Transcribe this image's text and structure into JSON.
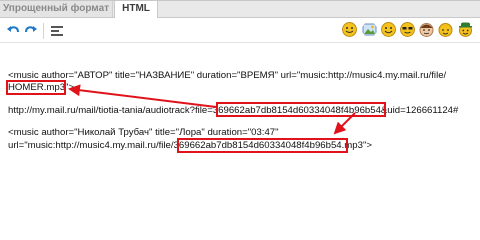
{
  "tabs": [
    {
      "label": "Упрощенный формат"
    },
    {
      "label": "HTML"
    }
  ],
  "toolbar": {
    "icons": [
      "undo-icon",
      "redo-icon",
      "format-icon",
      "image-icon",
      "video-icon",
      "music-icon",
      "smile-icon",
      "smile-wink-icon",
      "smile-cool-icon",
      "smile-girl-icon",
      "smile-hat-icon"
    ]
  },
  "editor": {
    "line1": "<music author=\"АВТОР\" title=\"НАЗВАНИЕ\" duration=\"ВРЕМЯ\" url=\"music:http://music4.my.mail.ru/file/",
    "line2": "HOMER.mp3\">",
    "line3": "http://my.mail.ru/mail/tiotia-tania/audiotrack?file=369662ab7db8154d60334048f4b96b54&uid=126661124#",
    "line4": "<music author=\"Николай Трубач\" title=\"Лора\" duration=\"03:47\"",
    "line5": "url=\"music:http://music4.my.mail.ru/file/369662ab7db8154d60334048f4b96b54.mp3\">"
  },
  "colors": {
    "highlight": "#e0131a",
    "tab_active_text": "#3b3b3b",
    "tab_inactive_text": "#8a8a8a"
  }
}
